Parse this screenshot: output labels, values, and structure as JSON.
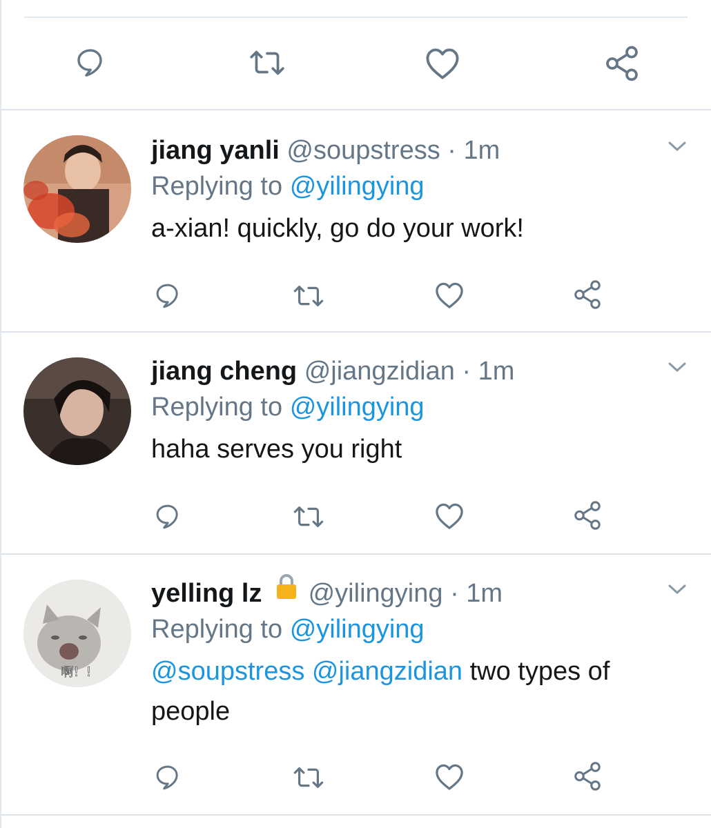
{
  "top_actions": [
    "reply-icon",
    "retweet-icon",
    "like-icon",
    "share-icon"
  ],
  "colors": {
    "text": "#14171a",
    "muted": "#657786",
    "link": "#1b95e0",
    "divider": "#e1e8ed"
  },
  "tweets": [
    {
      "name": "jiang yanli",
      "handle": "@soupstress",
      "sep": "·",
      "time": "1m",
      "replying_prefix": "Replying to",
      "replying_to": "@yilingying",
      "text": "a-xian! quickly, go do your work!"
    },
    {
      "name": "jiang cheng",
      "handle": "@jiangzidian",
      "sep": "·",
      "time": "1m",
      "replying_prefix": "Replying to",
      "replying_to": "@yilingying",
      "text": "haha serves you right"
    },
    {
      "name": "yelling lz",
      "handle": "@yilingying",
      "sep": "·",
      "time": "1m",
      "replying_prefix": "Replying to",
      "replying_to": "@yilingying",
      "mention_1": "@soupstress",
      "mention_2": "@jiangzidian",
      "text": "two types of people",
      "avatar_caption": "啊！！",
      "locked": true
    }
  ]
}
